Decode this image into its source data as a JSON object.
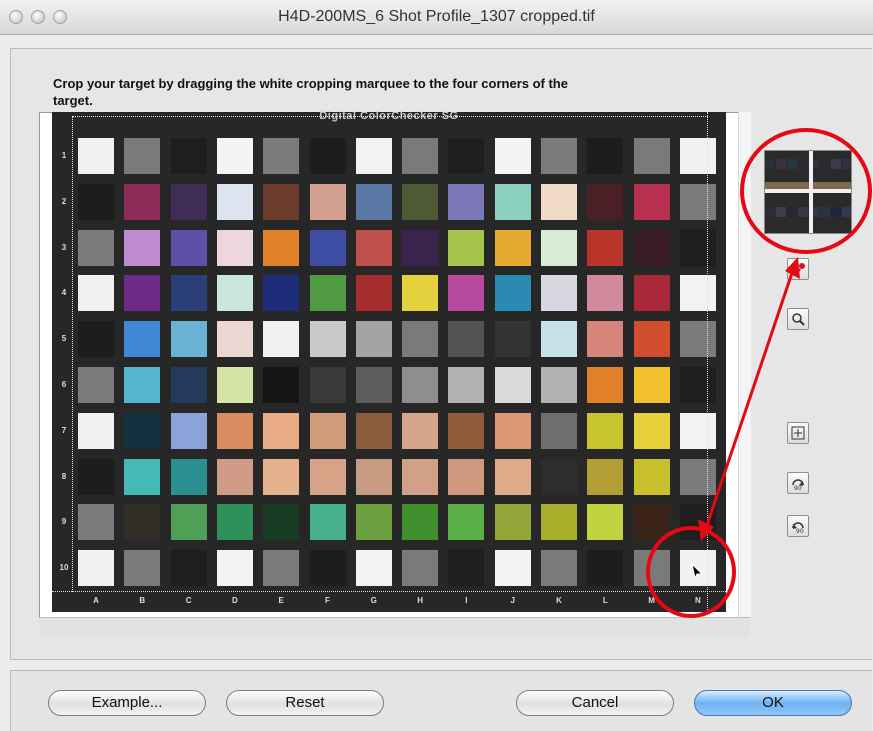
{
  "window": {
    "title": "H4D-200MS_6 Shot Profile_1307 cropped.tif"
  },
  "instructions": "Crop your target by dragging the white cropping marquee to the four corners of the target.",
  "target": {
    "chart_title": "Digital ColorChecker SG",
    "row_labels": [
      "1",
      "2",
      "3",
      "4",
      "5",
      "6",
      "7",
      "8",
      "9",
      "10"
    ],
    "col_labels": [
      "A",
      "B",
      "C",
      "D",
      "E",
      "F",
      "G",
      "H",
      "I",
      "J",
      "K",
      "L",
      "M",
      "N"
    ],
    "patches": [
      [
        "#f1f1f1",
        "#7a7a7a",
        "#1e1e1e",
        "#f4f4f4",
        "#7b7b7b",
        "#1d1d1d",
        "#f2f2f2",
        "#7a7a7a",
        "#1e1e1e",
        "#f3f3f3",
        "#7b7b7b",
        "#1d1d1d",
        "#7a7a7a",
        "#f1f1f1"
      ],
      [
        "#1d1d1d",
        "#8e2c5a",
        "#3f2d55",
        "#dde3ef",
        "#6b3c2b",
        "#d4a092",
        "#5a78a6",
        "#4e5a34",
        "#7c78b8",
        "#8cd0c0",
        "#f0dcc6",
        "#4a1f25",
        "#b8304f",
        "#7b7b7b"
      ],
      [
        "#7a7a7a",
        "#c18bd2",
        "#5e4fa8",
        "#edd6de",
        "#e1822b",
        "#3c4ea3",
        "#bf4f4a",
        "#3a234d",
        "#a6c34a",
        "#e5aa30",
        "#d8ecd8",
        "#b83528",
        "#3a1b28",
        "#1e1e1e"
      ],
      [
        "#f1f1f1",
        "#6e2a86",
        "#2a3f78",
        "#c8e6dc",
        "#1d2d7a",
        "#4f9a42",
        "#a42c2c",
        "#e5d23e",
        "#b74a9e",
        "#2a8ab3",
        "#d7d7e0",
        "#d08a9b",
        "#a8283a",
        "#f2f2f2"
      ],
      [
        "#1d1d1d",
        "#3f88d6",
        "#6ab2d4",
        "#ecd6d2",
        "#f0f0f0",
        "#c9c9c9",
        "#a4a4a4",
        "#7a7a7a",
        "#535353",
        "#333333",
        "#c7e0e8",
        "#d5857a",
        "#d04e2e",
        "#7b7b7b"
      ],
      [
        "#7a7a7a",
        "#54b5d1",
        "#233a5a",
        "#d6e3a6",
        "#151515",
        "#3a3a3a",
        "#5e5e5e",
        "#8e8e8e",
        "#b2b2b2",
        "#d9d9d9",
        "#b3b3b3",
        "#e08029",
        "#f1c12e",
        "#1e1e1e"
      ],
      [
        "#f1f1f1",
        "#12303e",
        "#8aa3da",
        "#d88c60",
        "#e8ad86",
        "#d29d7d",
        "#8c5c3e",
        "#d4a58a",
        "#915c3a",
        "#d99873",
        "#6f6f6f",
        "#c8c42c",
        "#e7d13d",
        "#f2f2f2"
      ],
      [
        "#1d1d1d",
        "#45b9b5",
        "#2a8f91",
        "#cf9a86",
        "#e5b08c",
        "#d7a386",
        "#c79b82",
        "#d2a088",
        "#cf987e",
        "#dfab8b",
        "#2d2d2d",
        "#b39f35",
        "#c9c02e",
        "#7b7b7b"
      ],
      [
        "#7a7a7a",
        "#2f2d24",
        "#4f9f57",
        "#2f8f58",
        "#183b24",
        "#46b08a",
        "#6da03e",
        "#3f8f2e",
        "#5ab046",
        "#94a63a",
        "#a8ad2a",
        "#c1d23f",
        "#3a2418",
        "#1e1e1e"
      ],
      [
        "#f1f1f1",
        "#7a7a7a",
        "#1e1e1e",
        "#f3f3f3",
        "#7b7b7b",
        "#1d1d1d",
        "#f2f2f2",
        "#7a7a7a",
        "#1e1e1e",
        "#f3f3f3",
        "#7b7b7b",
        "#1d1d1d",
        "#7a7a7a",
        "#f1f1f1"
      ]
    ]
  },
  "loupe_colors": [
    "#2e2e3a",
    "#3a2f3a",
    "#27353f",
    "#2b2b33",
    "#35313a",
    "#2a2a31",
    "#40384a",
    "#2f3040",
    "#2c2b37",
    "#3e3c49",
    "#282833",
    "#393545",
    "#323848",
    "#2a3345",
    "#1b2540",
    "#303a4a"
  ],
  "tools": {
    "eyedropper": "eyedropper-icon",
    "magnifier": "magnifier-icon",
    "move": "move-icon",
    "rotate_right": "rotate-right-90-icon",
    "rotate_left": "rotate-left-90-icon",
    "rotate_right_label": "90",
    "rotate_left_label": "90"
  },
  "annotation_color": "#e50914",
  "buttons": {
    "example": "Example...",
    "reset": "Reset",
    "cancel": "Cancel",
    "ok": "OK"
  }
}
